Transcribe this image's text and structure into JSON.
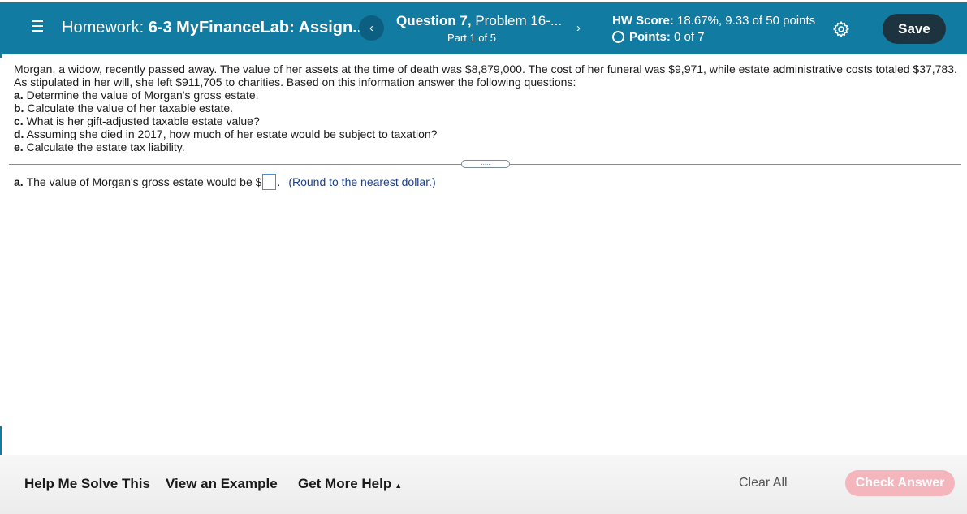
{
  "header": {
    "homework_prefix": "Homework:",
    "homework_name": "6-3 MyFinanceLab: Assign...",
    "prev_label": "‹",
    "next_label": "›",
    "question_label": "Question 7,",
    "problem_label": "Problem 16-...",
    "part_label": "Part 1 of 5",
    "hw_score_label": "HW Score:",
    "hw_score_value": "18.67%, 9.33 of 50 points",
    "points_label": "Points:",
    "points_value": "0 of 7",
    "save_label": "Save",
    "bar_color": "#117ba1"
  },
  "question": {
    "intro": "Morgan, a widow, recently passed away. The value of her assets at the time of death was $8,879,000. The cost of her funeral was $9,971, while estate administrative costs totaled $37,783. As stipulated in her will, she left $911,705 to charities. Based on this information answer the following questions:",
    "parts": [
      {
        "letter": "a.",
        "text": "Determine the value of Morgan's gross estate."
      },
      {
        "letter": "b.",
        "text": "Calculate the value of her taxable estate."
      },
      {
        "letter": "c.",
        "text": "What is her gift-adjusted taxable estate value?"
      },
      {
        "letter": "d.",
        "text": "Assuming she died in 2017, how much of her estate would be subject to taxation?"
      },
      {
        "letter": "e.",
        "text": "Calculate the estate tax liability."
      }
    ]
  },
  "divider": {
    "handle_label": "....."
  },
  "answer": {
    "letter": "a.",
    "prompt": "The value of Morgan's gross estate would be $",
    "value": "",
    "after": ".",
    "hint": "(Round to the nearest dollar.)"
  },
  "footer": {
    "help_solve": "Help Me Solve This",
    "view_example": "View an Example",
    "more_help": "Get More Help",
    "more_help_caret": "▲",
    "clear_all": "Clear All",
    "check_answer": "Check Answer"
  }
}
